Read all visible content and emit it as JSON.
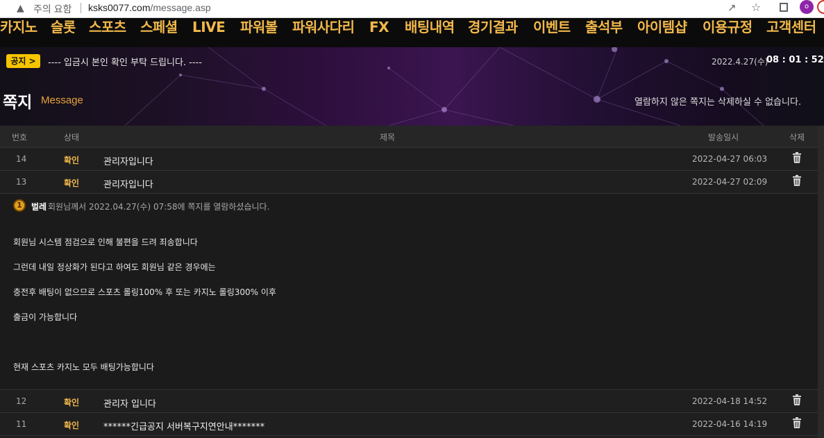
{
  "browser": {
    "warning_text": "주의 요함",
    "url_host": "ksks0077.com",
    "url_path": "/message.asp",
    "profile_initial": "o"
  },
  "nav": {
    "items": [
      "카지노",
      "슬롯",
      "스포츠",
      "스페셜",
      "LIVE",
      "파워볼",
      "파워사다리",
      "FX",
      "배팅내역",
      "경기결과",
      "이벤트",
      "출석부",
      "아이템샵",
      "이용규정",
      "고객센터"
    ]
  },
  "notice": {
    "badge": "공지 >",
    "text": "---- 입금시 본인 확인 부탁 드립니다. ----"
  },
  "clock": {
    "date": "2022.4.27(수)",
    "time": "08 : 01 : 52"
  },
  "page": {
    "title": "쪽지",
    "subtitle": "Message",
    "hint": "열람하지 않은 쪽지는 삭제하실 수 없습니다."
  },
  "table": {
    "headers": {
      "num": "번호",
      "status": "상태",
      "subject": "제목",
      "date": "발송일시",
      "delete": "삭제"
    },
    "rows": [
      {
        "num": "14",
        "status": "확인",
        "subject": "관리자입니다",
        "date": "2022-04-27 06:03"
      },
      {
        "num": "13",
        "status": "확인",
        "subject": "관리자입니다",
        "date": "2022-04-27 02:09"
      },
      {
        "num": "12",
        "status": "확인",
        "subject": "관리자 입니다",
        "date": "2022-04-18 14:52"
      },
      {
        "num": "11",
        "status": "확인",
        "subject": "******긴급공지 서버복구지연안내*******",
        "date": "2022-04-16 14:19"
      }
    ]
  },
  "read_info": {
    "level": "1",
    "name": "벌레",
    "message": "회원님께서 2022.04.27(수) 07:58에 쪽지를 열람하셨습니다."
  },
  "message_body": {
    "lines": [
      "회원님 시스템 점검으로 인해 불편을 드려 죄송합니다",
      "그런데 내일 정상화가 된다고 하여도 회원님 같은 경우에는",
      "충전후 배팅이 없으므로 스포츠 롤링100% 후 또는 카지노 롤링300% 이후",
      "출금이 가능합니다",
      "현재 스포츠 카지노 모두 배팅가능합니다"
    ]
  },
  "colors": {
    "accent": "#f2b84b",
    "notice_badge": "#f6c500",
    "background": "#1e1e1e"
  }
}
